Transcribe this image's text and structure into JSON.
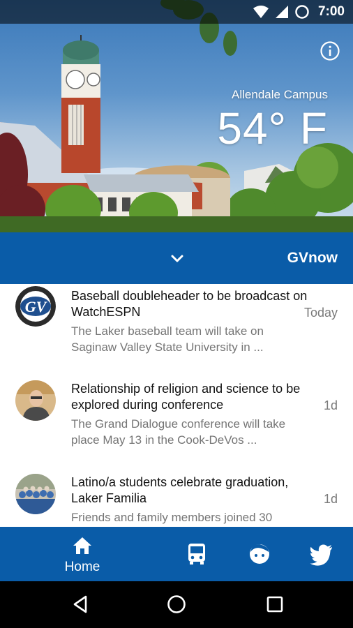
{
  "status_bar": {
    "time": "7:00",
    "icons": [
      "wifi-icon",
      "signal-icon",
      "do-not-disturb-icon"
    ]
  },
  "hero": {
    "info_icon": "info-icon",
    "location": "Allendale Campus",
    "temperature": "54° F"
  },
  "header": {
    "dropdown_icon": "chevron-down-icon",
    "title": "GVnow"
  },
  "news": [
    {
      "headline": "Baseball doubleheader to be broadcast on WatchESPN",
      "snippet": "The Laker baseball team will take on Saginaw Valley State University in ...",
      "time": "Today",
      "thumbnail": "gv-logo"
    },
    {
      "headline": "Relationship of religion and science to be explored during conference",
      "snippet": "The Grand Dialogue conference will take place May 13 in the Cook-DeVos ...",
      "time": "1d",
      "thumbnail": "speaker-photo"
    },
    {
      "headline": "Latino/a students celebrate graduation, Laker Familia",
      "snippet": "Friends and family members joined 30",
      "time": "1d",
      "thumbnail": "group-photo"
    }
  ],
  "bottom_nav": {
    "home_label": "Home",
    "items": [
      "home-icon",
      "bus-icon",
      "face-icon",
      "twitter-icon"
    ]
  },
  "system_nav": [
    "back-icon",
    "home-circle-icon",
    "recents-icon"
  ],
  "colors": {
    "brand_blue": "#0a5ca8",
    "headline": "#111111",
    "snippet": "#757575"
  }
}
